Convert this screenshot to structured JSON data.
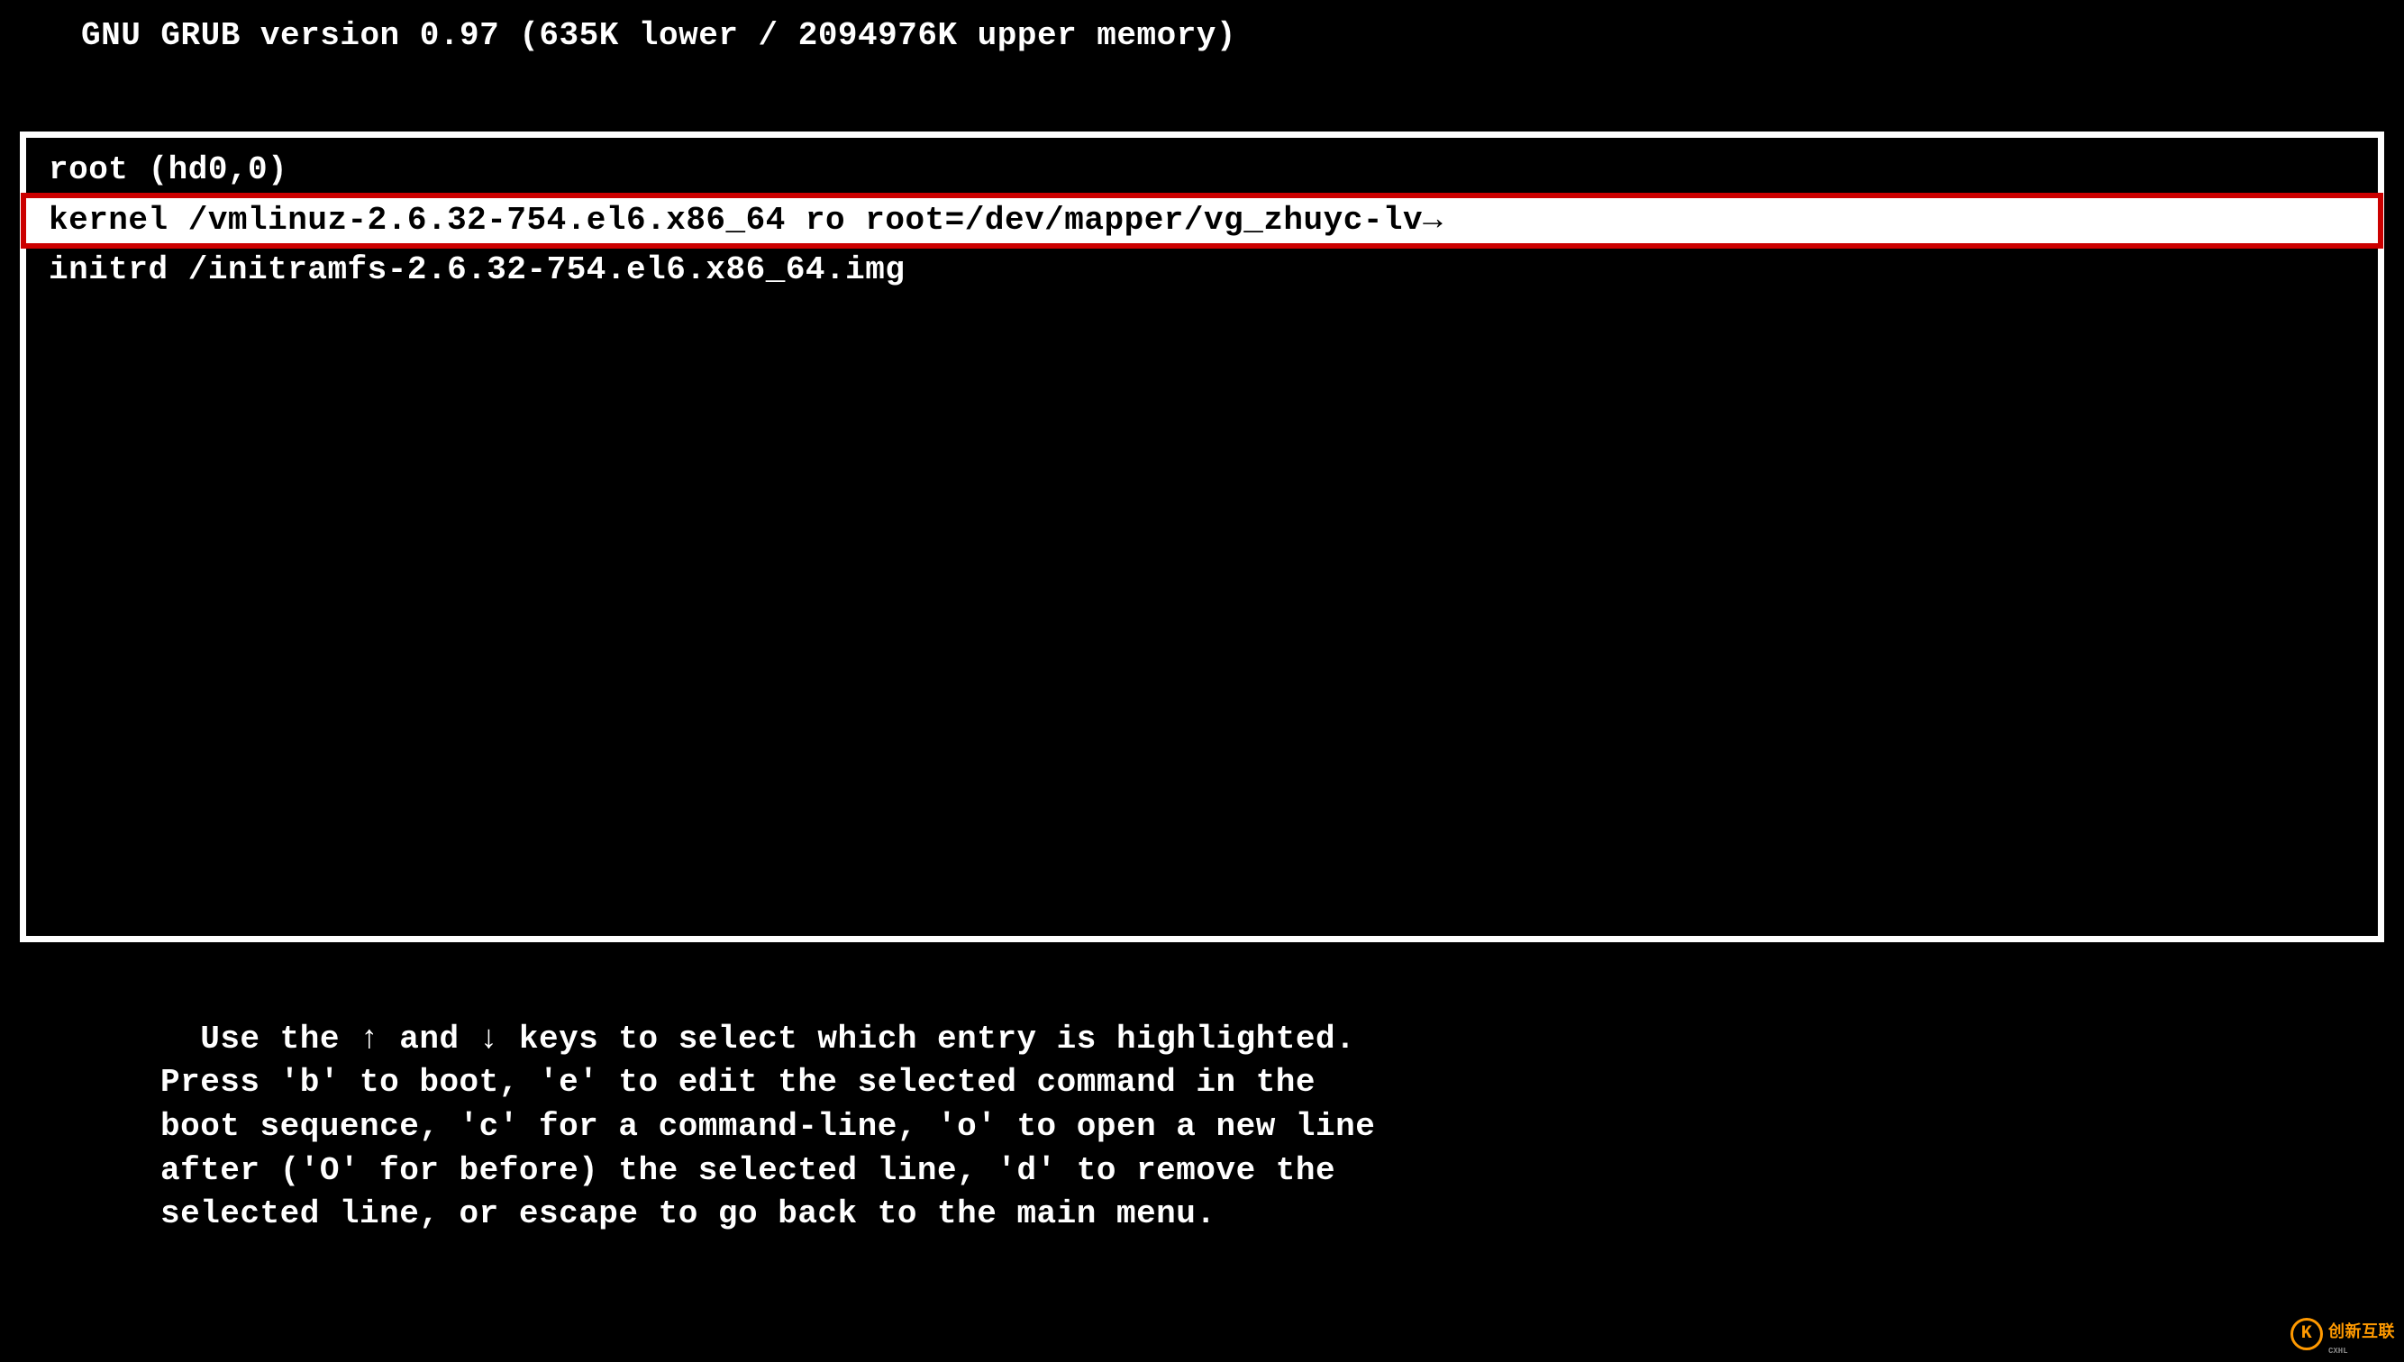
{
  "header": {
    "title": "GNU GRUB  version 0.97  (635K lower / 2094976K upper memory)"
  },
  "menu": {
    "lines": [
      "root (hd0,0)",
      "kernel /vmlinuz-2.6.32-754.el6.x86_64 ro root=/dev/mapper/vg_zhuyc-lv→",
      "initrd /initramfs-2.6.32-754.el6.x86_64.img"
    ],
    "highlighted_index": 1
  },
  "instructions": {
    "text": "Use the ↑ and ↓ keys to select which entry is highlighted.\nPress 'b' to boot, 'e' to edit the selected command in the\nboot sequence, 'c' for a command-line, 'o' to open a new line\nafter ('O' for before) the selected line, 'd' to remove the\nselected line, or escape to go back to the main menu."
  },
  "watermark": {
    "icon": "K",
    "text": "创新互联",
    "sub": "CXHL"
  }
}
